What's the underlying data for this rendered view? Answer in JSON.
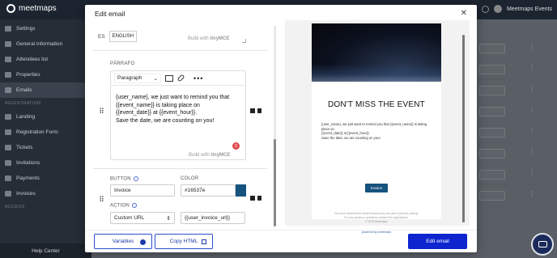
{
  "app": {
    "brand": "meetmaps",
    "user_name": "Meetmaps Events"
  },
  "sidebar": {
    "items": [
      {
        "label": "Settings",
        "active": false
      },
      {
        "label": "General information",
        "active": false
      },
      {
        "label": "Attendees list",
        "active": false
      },
      {
        "label": "Properties",
        "active": false
      },
      {
        "label": "Emails",
        "active": true
      }
    ],
    "section_registration": "REGISTRATION",
    "registration_items": [
      {
        "label": "Landing"
      },
      {
        "label": "Registration Form"
      },
      {
        "label": "Tickets"
      },
      {
        "label": "Invitations"
      },
      {
        "label": "Payments"
      },
      {
        "label": "Invoices"
      }
    ],
    "section_access": "ACCESS",
    "help_center": "Help Center"
  },
  "modal": {
    "title": "Edit email",
    "language": {
      "code": "ES",
      "tab": "ENGLISH"
    },
    "built_with": "Build with",
    "built_with_brand": "tinyMCE",
    "paragraph": {
      "label": "PÁRRAFO",
      "format_select": "Paragraph",
      "content": "{user_name}, we just want to remind you that\n{{event_name}} is taking place on\n{{event_date}} at {{event_hour}}.\nSave the date, we are counting on you!",
      "badge_count": "5"
    },
    "button_block": {
      "button_label": "BUTTON",
      "button_value": "Invoice",
      "color_label": "COLOR",
      "color_value": "#16537e",
      "action_label": "ACTION",
      "action_value": "Custom URL",
      "url_value": "{{user_invoice_url}}"
    },
    "preview": {
      "title": "DON'T MISS THE EVENT",
      "text": "{user_name}, we just want to remind you that {{event_name}} is taking place on\n{{event_date}} at {{event_hour}}.\nSave the date, we are counting on you!",
      "button": "Invoice",
      "footer": "You have received this email because you are part of {{event_name}}.\nFor any issues or questions contact the organization.\n© 2023 Meetmaps",
      "powered_by": "powered by meetmaps"
    },
    "footer": {
      "variables_button": "Variables",
      "copy_html_button": "Copy HTML",
      "save_button": "Edit email"
    }
  },
  "colors": {
    "accent": "#0d24cf",
    "button_color": "#16537e",
    "sidebar_bg": "#262d37"
  }
}
